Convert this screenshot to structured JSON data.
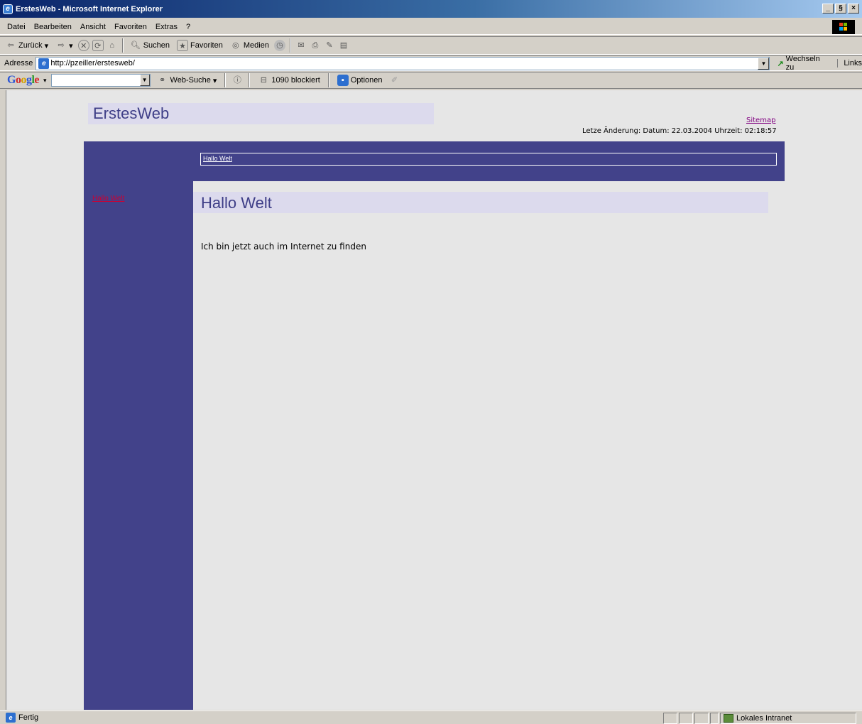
{
  "window": {
    "title": "ErstesWeb - Microsoft Internet Explorer",
    "min": "_",
    "max": "§",
    "close": "×"
  },
  "menubar": {
    "items": [
      "Datei",
      "Bearbeiten",
      "Ansicht",
      "Favoriten",
      "Extras",
      "?"
    ]
  },
  "toolbar": {
    "back": "Zurück",
    "search": "Suchen",
    "favorites": "Favoriten",
    "media": "Medien"
  },
  "addressbar": {
    "label": "Adresse",
    "url": "http://pzeiller/erstesweb/",
    "go": "Wechseln zu",
    "links": "Links"
  },
  "googlebar": {
    "web_search": "Web-Suche",
    "blocked": "1090 blockiert",
    "options": "Optionen"
  },
  "page": {
    "site_title": "ErstesWeb",
    "sitemap": "Sitemap",
    "last_change": "Letze Änderung: Datum: 22.03.2004 Uhrzeit: 02:18:57",
    "breadcrumb": "Hallo Welt",
    "left_nav": "Hallo Welt",
    "content_title": "Hallo Welt",
    "content_body": "Ich bin jetzt auch im Internet zu finden"
  },
  "statusbar": {
    "text": "Fertig",
    "zone": "Lokales Intranet"
  },
  "colors": {
    "accent": "#42428a",
    "title_bg": "#dcdaed",
    "page_bg": "#e6e6e6",
    "nav_link": "#cc0033",
    "visited_link": "#800080"
  }
}
